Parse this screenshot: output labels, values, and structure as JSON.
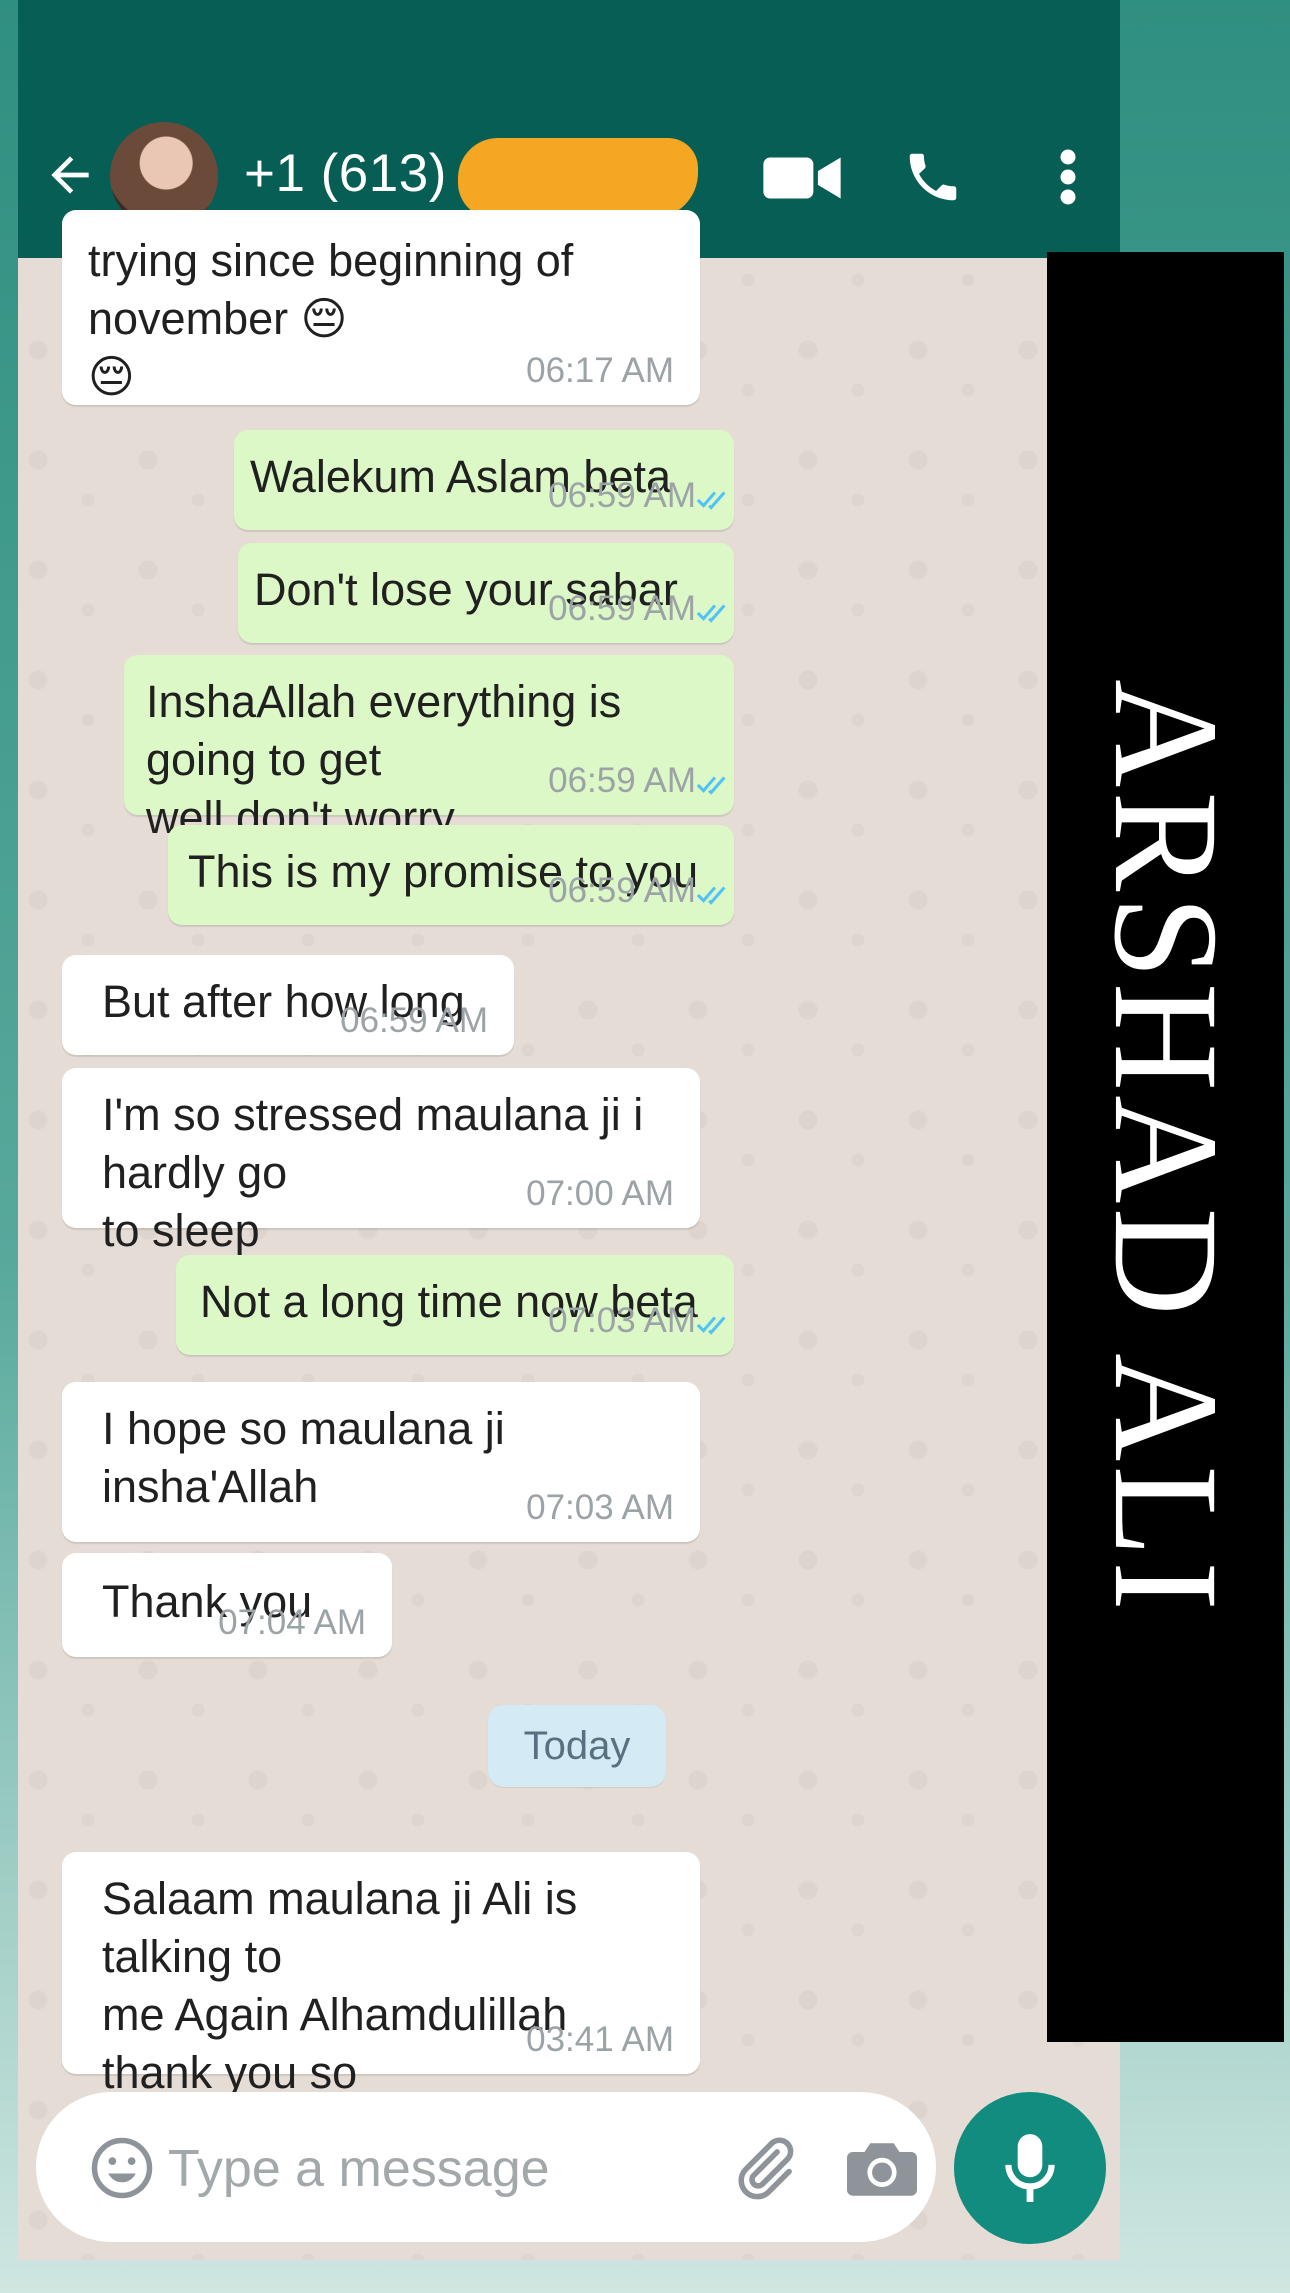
{
  "header": {
    "contact_name": "+1 (613)",
    "icons": [
      "back-arrow-icon",
      "avatar",
      "video-camera-icon",
      "phone-icon",
      "more-vertical-icon"
    ],
    "color": "#075e54"
  },
  "messages": [
    {
      "direction": "in",
      "text": "trying since beginning of november 😔\n😔",
      "time": "06:17 AM"
    },
    {
      "direction": "out",
      "text": "Walekum Aslam beta",
      "time": "06:59 AM",
      "status": "read"
    },
    {
      "direction": "out",
      "text": "Don't lose your sabar",
      "time": "06:59 AM",
      "status": "read"
    },
    {
      "direction": "out",
      "text": "InshaAllah everything is going to get\nwell don't worry",
      "time": "06:59 AM",
      "status": "read"
    },
    {
      "direction": "out",
      "text": "This is my promise to you",
      "time": "06:59 AM",
      "status": "read"
    },
    {
      "direction": "in",
      "text": "But after how long",
      "time": "06:59 AM"
    },
    {
      "direction": "in",
      "text": "I'm so stressed maulana ji i hardly go\nto sleep",
      "time": "07:00 AM"
    },
    {
      "direction": "out",
      "text": "Not a long time now beta",
      "time": "07:03 AM",
      "status": "read"
    },
    {
      "direction": "in",
      "text": "I hope so maulana ji insha'Allah",
      "time": "07:03 AM"
    },
    {
      "direction": "in",
      "text": "Thank you",
      "time": "07:04 AM"
    },
    {
      "direction": "in",
      "text": "Salaam maulana ji Ali is talking to\nme Again Alhamdulillah thank you so\nmuch",
      "time": "03:41 AM"
    }
  ],
  "date_separator": "Today",
  "composer": {
    "placeholder": "Type a message",
    "icons": [
      "emoji-icon",
      "paperclip-icon",
      "camera-icon",
      "microphone-icon"
    ]
  },
  "watermark": "ARSHAD ALI",
  "colors": {
    "incoming_bubble": "#ffffff",
    "outgoing_bubble": "#dcf8c6",
    "read_ticks": "#4fc3f7",
    "mic_button": "#128c7e"
  }
}
